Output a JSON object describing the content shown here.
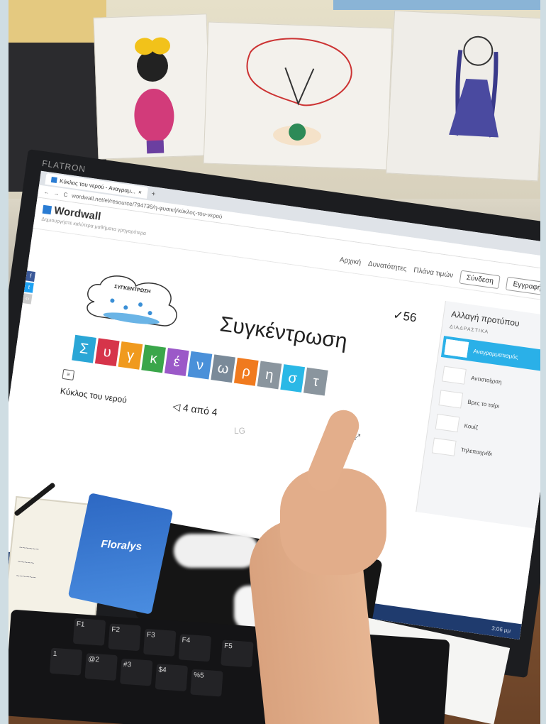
{
  "browser": {
    "tab_label": "Κύκλος του νερού - Αναγραμ...",
    "url": "wordwall.net/el/resource/794736/η-φυσική/κύκλος-του-νερού"
  },
  "site": {
    "logo": "Wordwall",
    "tagline": "Δημιουργήστε καλύτερα μαθήματα γρηγορότερα",
    "nav": [
      "Αρχική",
      "Δυνατότητες",
      "Πλάνα τιμών"
    ],
    "login_label": "Σύνδεση",
    "signup_label": "Εγγραφή"
  },
  "activity": {
    "cloud_label": "ΣΥΓΚΕΝΤΡΩΣΗ",
    "score": "✓56",
    "target_word": "Συγκέντρωση",
    "tiles": [
      {
        "letter": "Σ",
        "color": "#2aa6d6"
      },
      {
        "letter": "υ",
        "color": "#d6344a"
      },
      {
        "letter": "γ",
        "color": "#f09a1e"
      },
      {
        "letter": "κ",
        "color": "#3aa64a"
      },
      {
        "letter": "έ",
        "color": "#9b59c8"
      },
      {
        "letter": "ν",
        "color": "#4a90d9"
      },
      {
        "letter": "ω",
        "color": "#7a8a99"
      },
      {
        "letter": "ρ",
        "color": "#f07a1e"
      },
      {
        "letter": "η",
        "color": "#8a959e"
      },
      {
        "letter": "σ",
        "color": "#2ab8e6"
      },
      {
        "letter": "τ",
        "color": "#8a959e"
      }
    ],
    "title": "Κύκλος του νερού",
    "pager": "◁ 4 από 4"
  },
  "sidebar": {
    "title": "Αλλαγή προτύπου",
    "section": "ΔΙΑΔΡΑΣΤΙΚΑ",
    "items": [
      {
        "label": "Αναγραμματισμός",
        "active": true
      },
      {
        "label": "Αντιστοίχιση",
        "active": false
      },
      {
        "label": "Βρες το ταίρι",
        "active": false
      },
      {
        "label": "Κουίζ",
        "active": false
      },
      {
        "label": "Τηλεπαιχνίδι",
        "active": false
      }
    ]
  },
  "taskbar": {
    "clock": "3:06 μμ"
  },
  "monitor": {
    "brand": "FLATRON",
    "maker": "LG"
  },
  "tissues": {
    "brand": "Floralys"
  },
  "keyboard": {
    "keys": [
      "F1",
      "F2",
      "F3",
      "F4",
      "F5",
      "1",
      "@2",
      "#3",
      "$4",
      "%5"
    ]
  },
  "colors": {
    "brand_blue": "#2a7cd3",
    "sidebar_active": "#2ab0e8"
  }
}
